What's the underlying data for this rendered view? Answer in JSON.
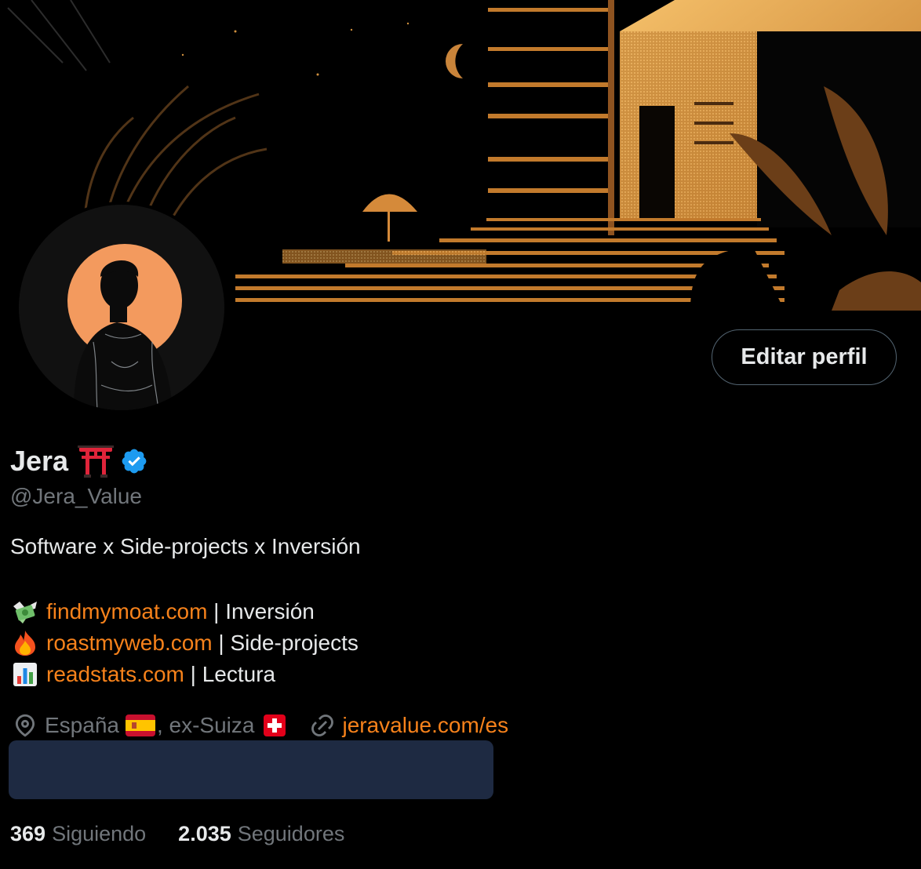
{
  "profile": {
    "name": "Jera",
    "handle": "@Jera_Value",
    "bio": "Software x Side-projects x Inversión",
    "edit_button_label": "Editar perfil",
    "verified": true
  },
  "links": [
    {
      "icon": "money-with-wings-icon",
      "url_text": "findmymoat.com",
      "suffix": " | Inversión"
    },
    {
      "icon": "fire-icon",
      "url_text": "roastmyweb.com",
      "suffix": " | Side-projects"
    },
    {
      "icon": "bar-chart-icon",
      "url_text": "readstats.com",
      "suffix": " | Lectura"
    }
  ],
  "meta": {
    "location_part1": "España",
    "location_part2": ", ex-Suiza",
    "website": "jeravalue.com/es"
  },
  "stats": {
    "following_count": "369",
    "following_label": "Siguiendo",
    "followers_count": "2.035",
    "followers_label": "Seguidores"
  },
  "colors": {
    "background": "#000000",
    "text_primary": "#e7e9ea",
    "text_secondary": "#71767b",
    "link_accent": "#f7821b",
    "verified_badge": "#1d9bf0",
    "avatar_sun": "#f39a5e",
    "redaction_block": "#1e2a42"
  }
}
